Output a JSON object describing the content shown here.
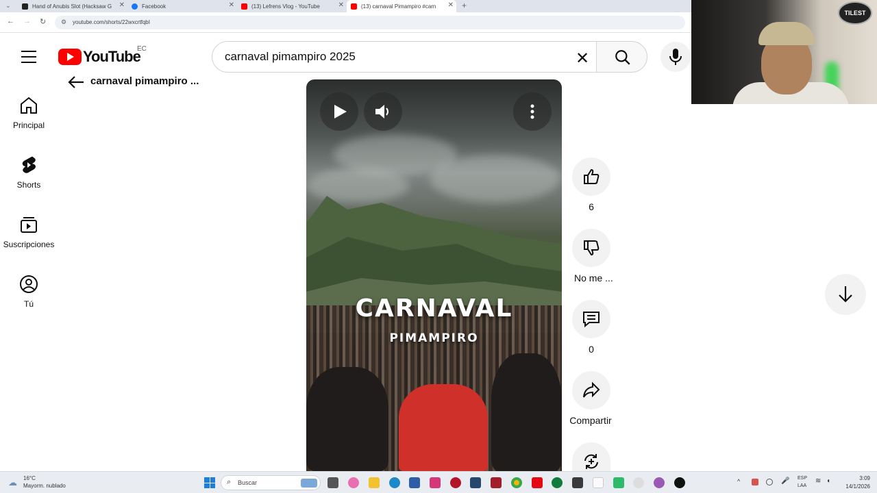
{
  "browser": {
    "tabs": [
      {
        "title": "Hand of Anubis Slot (Hacksaw G",
        "favicon_color": "#222222",
        "active": false
      },
      {
        "title": "Facebook",
        "favicon_color": "#1877f2",
        "active": false
      },
      {
        "title": "(13) Lefrens Vlog - YouTube",
        "favicon_color": "#ff0000",
        "active": false
      },
      {
        "title": "(13) carnaval Pimampiro #carn",
        "favicon_color": "#ff0000",
        "active": true
      }
    ],
    "new_tab": "+",
    "url": "youtube.com/shorts/22wxcrtfqbI"
  },
  "youtube": {
    "logo_text": "YouTube",
    "country": "EC",
    "search": {
      "value": "carnaval pimampiro 2025",
      "placeholder": "Buscar"
    },
    "sidebar": [
      {
        "label": "Principal",
        "icon": "home-icon"
      },
      {
        "label": "Shorts",
        "icon": "shorts-icon"
      },
      {
        "label": "Suscripciones",
        "icon": "subscriptions-icon"
      },
      {
        "label": "Tú",
        "icon": "account-icon"
      }
    ],
    "shorts_title": "carnaval pimampiro ...",
    "video": {
      "title": "CARNAVAL",
      "subtitle": "PIMAMPIRO"
    },
    "actions": {
      "like_count": "6",
      "dislike_label": "No me ...",
      "comment_count": "0",
      "share_label": "Compartir"
    }
  },
  "taskbar": {
    "weather_temp": "16°C",
    "weather_desc": "Mayorm. nublado",
    "search_label": "Buscar",
    "lang_top": "ESP",
    "lang_bottom": "LAA",
    "time": "3:09",
    "date": "14/1/2026"
  },
  "webcam": {
    "badge": "TILEST"
  }
}
